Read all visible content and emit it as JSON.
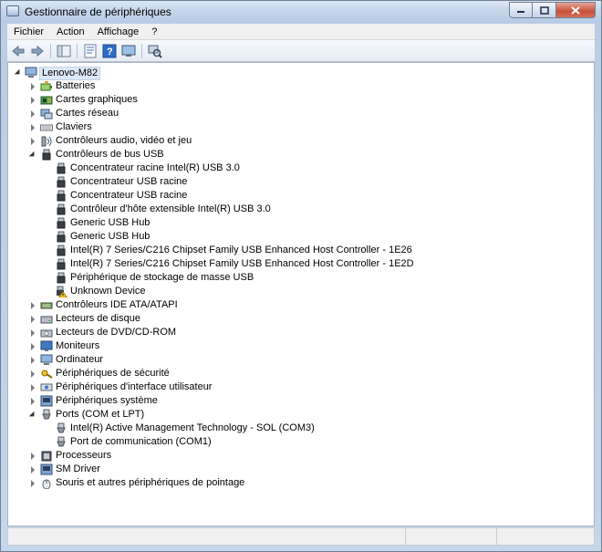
{
  "window": {
    "title": "Gestionnaire de périphériques"
  },
  "menu": [
    {
      "label": "Fichier"
    },
    {
      "label": "Action"
    },
    {
      "label": "Affichage"
    },
    {
      "label": "?"
    }
  ],
  "toolbar": [
    "back-arrow-icon",
    "forward-arrow-icon",
    "console-tree-icon",
    "properties-icon",
    "help-icon",
    "monitor-icon",
    "scan-hardware-icon"
  ],
  "tree": {
    "root": "Lenovo-M82",
    "categories": [
      {
        "label": "Batteries",
        "icon": "battery-icon",
        "expanded": false,
        "children": []
      },
      {
        "label": "Cartes graphiques",
        "icon": "display-adapter-icon",
        "expanded": false,
        "children": []
      },
      {
        "label": "Cartes réseau",
        "icon": "network-adapter-icon",
        "expanded": false,
        "children": []
      },
      {
        "label": "Claviers",
        "icon": "keyboard-icon",
        "expanded": false,
        "children": []
      },
      {
        "label": "Contrôleurs audio, vidéo et jeu",
        "icon": "audio-icon",
        "expanded": false,
        "children": []
      },
      {
        "label": "Contrôleurs de bus USB",
        "icon": "usb-icon",
        "expanded": true,
        "children": [
          {
            "label": "Concentrateur racine Intel(R) USB 3.0",
            "icon": "usb-icon"
          },
          {
            "label": "Concentrateur USB racine",
            "icon": "usb-icon"
          },
          {
            "label": "Concentrateur USB racine",
            "icon": "usb-icon"
          },
          {
            "label": "Contrôleur d'hôte extensible Intel(R) USB 3.0",
            "icon": "usb-icon"
          },
          {
            "label": "Generic USB Hub",
            "icon": "usb-icon"
          },
          {
            "label": "Generic USB Hub",
            "icon": "usb-icon"
          },
          {
            "label": "Intel(R) 7 Series/C216 Chipset Family USB Enhanced Host Controller - 1E26",
            "icon": "usb-icon"
          },
          {
            "label": "Intel(R) 7 Series/C216 Chipset Family USB Enhanced Host Controller - 1E2D",
            "icon": "usb-icon"
          },
          {
            "label": "Périphérique de stockage de masse USB",
            "icon": "usb-icon"
          },
          {
            "label": "Unknown Device",
            "icon": "warning-usb-icon"
          }
        ]
      },
      {
        "label": "Contrôleurs IDE ATA/ATAPI",
        "icon": "ide-icon",
        "expanded": false,
        "children": []
      },
      {
        "label": "Lecteurs de disque",
        "icon": "disk-drive-icon",
        "expanded": false,
        "children": []
      },
      {
        "label": "Lecteurs de DVD/CD-ROM",
        "icon": "dvd-icon",
        "expanded": false,
        "children": []
      },
      {
        "label": "Moniteurs",
        "icon": "monitor-icon",
        "expanded": false,
        "children": []
      },
      {
        "label": "Ordinateur",
        "icon": "computer-icon",
        "expanded": false,
        "children": []
      },
      {
        "label": "Périphériques de sécurité",
        "icon": "security-icon",
        "expanded": false,
        "children": []
      },
      {
        "label": "Périphériques d'interface utilisateur",
        "icon": "hid-icon",
        "expanded": false,
        "children": []
      },
      {
        "label": "Périphériques système",
        "icon": "system-device-icon",
        "expanded": false,
        "children": []
      },
      {
        "label": "Ports (COM et LPT)",
        "icon": "port-icon",
        "expanded": true,
        "children": [
          {
            "label": "Intel(R) Active Management Technology - SOL (COM3)",
            "icon": "port-icon"
          },
          {
            "label": "Port de communication (COM1)",
            "icon": "port-icon"
          }
        ]
      },
      {
        "label": "Processeurs",
        "icon": "processor-icon",
        "expanded": false,
        "children": []
      },
      {
        "label": "SM Driver",
        "icon": "system-device-icon",
        "expanded": false,
        "children": []
      },
      {
        "label": "Souris et autres périphériques de pointage",
        "icon": "mouse-icon",
        "expanded": false,
        "children": []
      }
    ]
  }
}
